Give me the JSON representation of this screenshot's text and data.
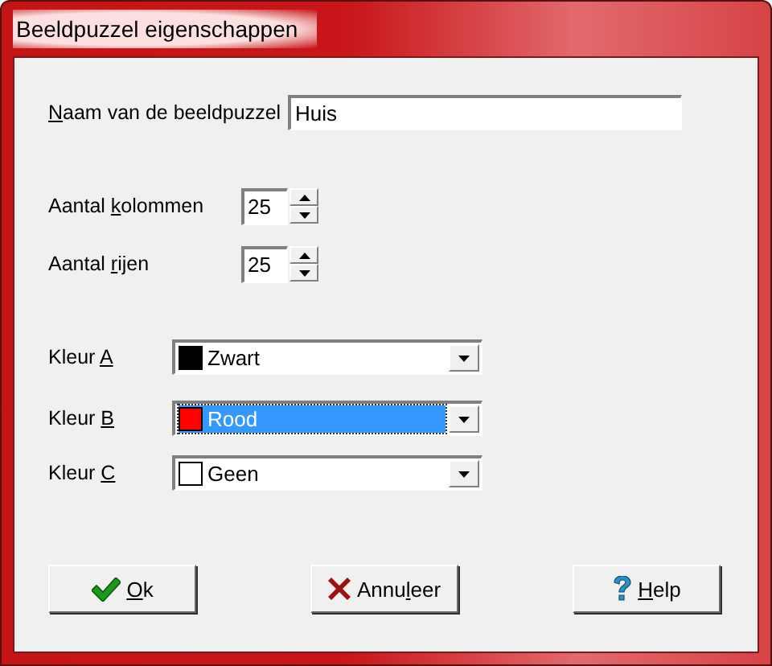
{
  "window": {
    "title": "Beeldpuzzel eigenschappen"
  },
  "name_field": {
    "label": {
      "key": "N",
      "after": "aam van de beeldpuzzel"
    },
    "value": "Huis"
  },
  "spinners": [
    {
      "label": {
        "before": "Aantal ",
        "key": "k",
        "after": "olommen"
      },
      "value": "25"
    },
    {
      "label": {
        "before": "Aantal ",
        "key": "r",
        "after": "ijen"
      },
      "value": "25"
    }
  ],
  "colors": [
    {
      "label": {
        "before": "Kleur ",
        "key": "A"
      },
      "value": "Zwart",
      "color": "#000000",
      "focused": false
    },
    {
      "label": {
        "before": "Kleur ",
        "key": "B"
      },
      "value": "Rood",
      "color": "#ff0000",
      "focused": true
    },
    {
      "label": {
        "before": "Kleur ",
        "key": "C"
      },
      "value": "Geen",
      "color": "#ffffff",
      "focused": false
    }
  ],
  "buttons": [
    {
      "kind": "ok",
      "label": {
        "key": "O",
        "after": "k"
      }
    },
    {
      "kind": "cancel",
      "label": {
        "before": "Annu",
        "key": "l",
        "after": "eer"
      }
    },
    {
      "kind": "help",
      "label": {
        "key": "H",
        "after": "elp"
      }
    }
  ]
}
